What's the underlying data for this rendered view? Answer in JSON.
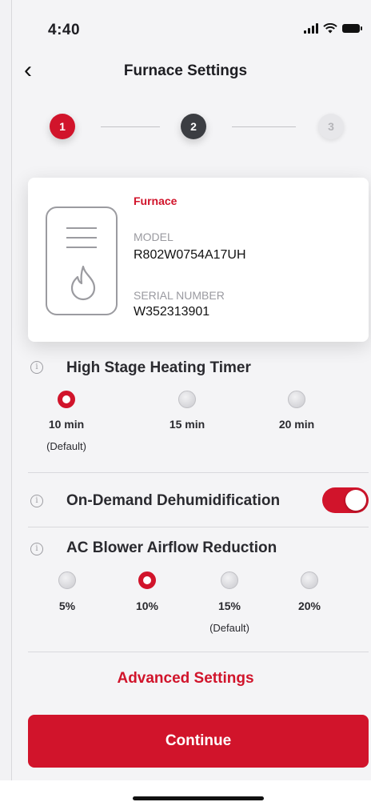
{
  "status_bar": {
    "time": "4:40"
  },
  "header": {
    "title": "Furnace Settings"
  },
  "stepper": {
    "steps": [
      "1",
      "2",
      "3"
    ],
    "current": 1
  },
  "device_card": {
    "type_label": "Furnace",
    "model_label": "MODEL",
    "model_value": "R802W0754A17UH",
    "serial_label": "SERIAL NUMBER",
    "serial_value": "W352313901"
  },
  "high_stage_timer": {
    "title": "High Stage Heating Timer",
    "options": [
      {
        "label": "10 min",
        "note": "(Default)",
        "selected": true
      },
      {
        "label": "15 min",
        "selected": false
      },
      {
        "label": "20 min",
        "selected": false
      }
    ]
  },
  "dehumidification": {
    "title": "On-Demand Dehumidification",
    "enabled": true
  },
  "ac_blower": {
    "title": "AC Blower Airflow Reduction",
    "options": [
      {
        "label": "5%",
        "selected": false
      },
      {
        "label": "10%",
        "selected": true
      },
      {
        "label": "15%",
        "note": "(Default)",
        "selected": false
      },
      {
        "label": "20%",
        "selected": false
      }
    ]
  },
  "advanced_settings_label": "Advanced Settings",
  "continue_label": "Continue",
  "colors": {
    "accent": "#d1142b",
    "step_active": "#3b3d42",
    "background": "#f4f4f6"
  }
}
